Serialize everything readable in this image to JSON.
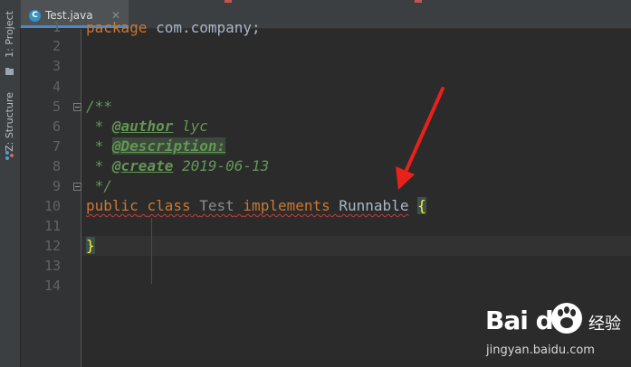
{
  "tool_window_strip": {
    "project_label": "1: Project",
    "structure_label": "Z: Structure"
  },
  "tabs": [
    {
      "label": "Test.java",
      "icon": "class-c-icon",
      "icon_letter": "C",
      "close_glyph": "✕"
    }
  ],
  "editor": {
    "line_numbers": [
      "1",
      "2",
      "3",
      "4",
      "5",
      "6",
      "7",
      "8",
      "9",
      "10",
      "11",
      "12",
      "13",
      "14"
    ],
    "code": {
      "line1_kw": "package",
      "line1_rest": " com.company;",
      "line5": "/**",
      "line6_prefix": " * ",
      "line6_tag": "@author",
      "line6_text": " lyc",
      "line7_prefix": " * ",
      "line7_tag": "@Description:",
      "line8_prefix": " * ",
      "line8_tag": "@create",
      "line8_text": " 2019-06-13",
      "line9": " */",
      "line10_public": "public",
      "line10_class": "class",
      "line10_name": "Test",
      "line10_implements": "implements",
      "line10_iface": "Runnable",
      "line10_brace": "{",
      "line12_brace": "}"
    }
  },
  "colors": {
    "background": "#2b2b2b",
    "keyword": "#cc7832",
    "comment": "#629755",
    "arrow": "#e8211b"
  },
  "watermark": {
    "logo_text": "Bai du",
    "cn_text": "经验",
    "url": "jingyan.baidu.com"
  }
}
